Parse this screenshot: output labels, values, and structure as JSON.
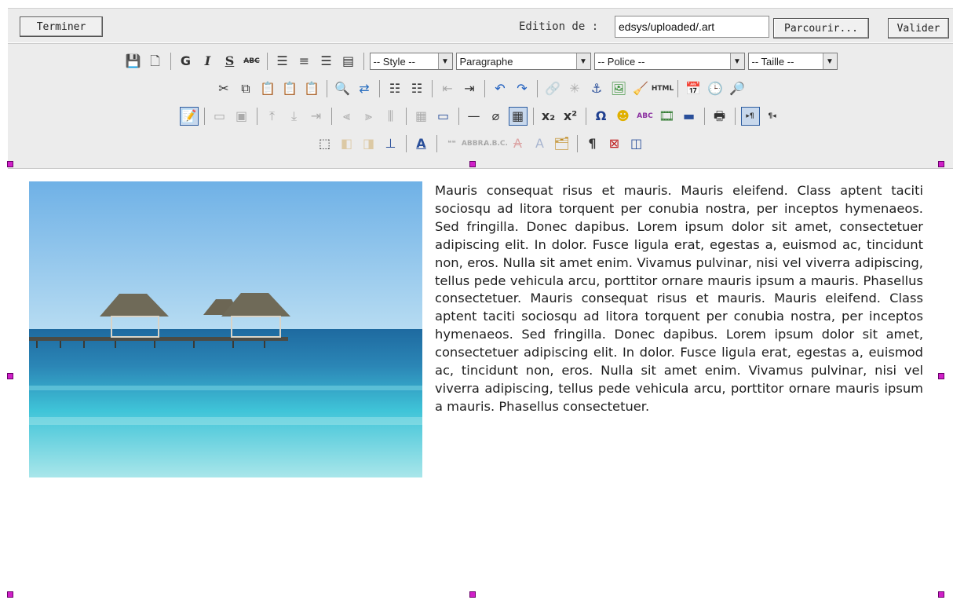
{
  "topbar": {
    "finish_button": "Terminer",
    "edit_label": "Edition de :",
    "path_value": "edsys/uploaded/.art",
    "browse_button": "Parcourir...",
    "validate_button": "Valider"
  },
  "toolbar": {
    "style_select": "-- Style --",
    "paragraph_select": "Paragraphe",
    "font_select": "-- Police --",
    "size_select": "-- Taille --",
    "labels": {
      "bold": "G",
      "italic": "I",
      "underline": "S",
      "strikethrough": "ABC",
      "html": "HTML",
      "subscript": "x₂",
      "superscript": "x²",
      "special_char": "Ω",
      "spellcheck": "ABC",
      "quote": "❝❝",
      "abbr": "ABBR.",
      "acronym": "A.B.C.",
      "pilcrow": "¶",
      "ltr": "▸¶",
      "rtl": "¶◂"
    }
  },
  "content": {
    "image_alt": "",
    "paragraph": "Mauris consequat risus et mauris. Mauris eleifend. Class aptent taciti sociosqu ad litora torquent per conubia nostra, per inceptos hymenaeos. Sed fringilla. Donec dapibus. Lorem ipsum dolor sit amet, consectetuer adipiscing elit. In dolor. Fusce ligula erat, egestas a, euismod ac, tincidunt non, eros. Nulla sit amet enim. Vivamus pulvinar, nisi vel viverra adipiscing, tellus pede vehicula arcu, porttitor ornare mauris ipsum a mauris. Phasellus consectetuer. Mauris consequat risus et mauris. Mauris eleifend. Class aptent taciti sociosqu ad litora torquent per conubia nostra, per inceptos hymenaeos. Sed fringilla. Donec dapibus. Lorem ipsum dolor sit amet, consectetuer adipiscing elit. In dolor. Fusce ligula erat, egestas a, euismod ac, tincidunt non, eros. Nulla sit amet enim. Vivamus pulvinar, nisi vel viverra adipiscing, tellus pede vehicula arcu, porttitor ornare mauris ipsum a mauris. Phasellus consectetuer."
  },
  "colors": {
    "handle": "#d020c8",
    "toolbar_bg": "#ececec",
    "pressed_border": "#2d5da0"
  }
}
